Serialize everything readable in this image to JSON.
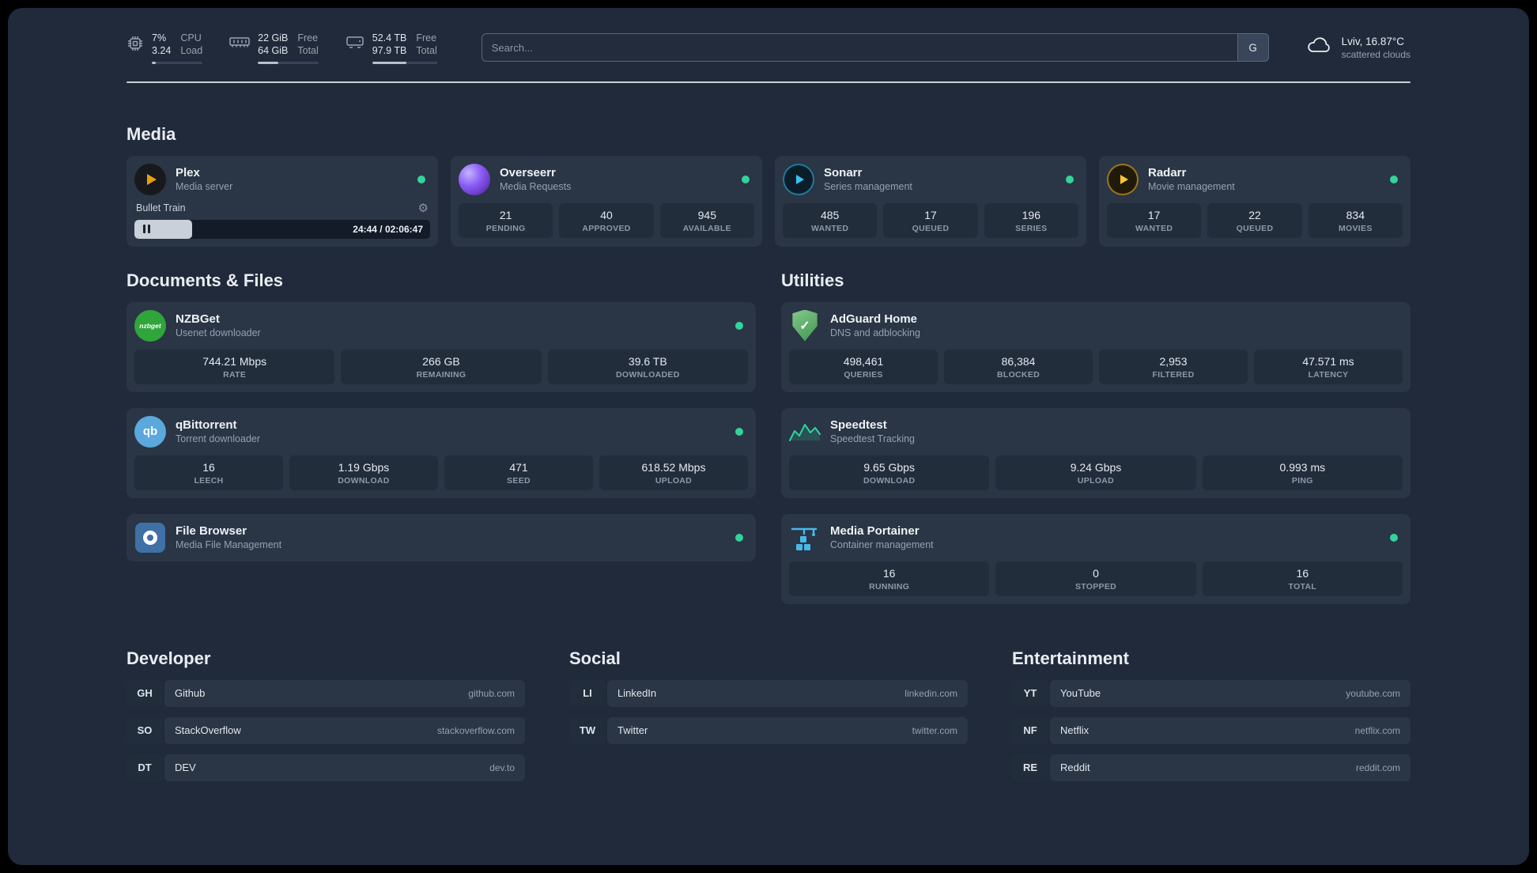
{
  "colors": {
    "status_online": "#34d399",
    "accent_plex": "#e5a00d",
    "accent_sonarr": "#35c5f4",
    "accent_radarr": "#ffc230",
    "accent_nzbget": "#2fa53b",
    "accent_qbittorrent": "#5ba8dc",
    "accent_adguard": "#6abd72",
    "accent_speedtest": "#2fd49c",
    "accent_portainer": "#49b8e8"
  },
  "icons": {
    "gear": "⚙",
    "adguard_check": "✓",
    "nzbget_label": "nzbget",
    "qbittorrent_label": "qb"
  },
  "topbar": {
    "cpu": {
      "value1": "7%",
      "value2": "3.24",
      "label1": "CPU",
      "label2": "Load"
    },
    "memory": {
      "value1": "22 GiB",
      "value2": "64 GiB",
      "label1": "Free",
      "label2": "Total"
    },
    "disk": {
      "value1": "52.4 TB",
      "value2": "97.9 TB",
      "label1": "Free",
      "label2": "Total"
    },
    "search": {
      "placeholder": "Search...",
      "provider_button": "G"
    },
    "weather": {
      "location": "Lviv, 16.87°C",
      "condition": "scattered clouds"
    }
  },
  "media": {
    "heading": "Media",
    "plex": {
      "title": "Plex",
      "subtitle": "Media server",
      "now_playing": "Bullet Train",
      "time": "24:44 / 02:06:47",
      "progress_percent": 19.5
    },
    "overseerr": {
      "title": "Overseerr",
      "subtitle": "Media Requests",
      "stats": [
        {
          "value": "21",
          "label": "PENDING"
        },
        {
          "value": "40",
          "label": "APPROVED"
        },
        {
          "value": "945",
          "label": "AVAILABLE"
        }
      ]
    },
    "sonarr": {
      "title": "Sonarr",
      "subtitle": "Series management",
      "stats": [
        {
          "value": "485",
          "label": "WANTED"
        },
        {
          "value": "17",
          "label": "QUEUED"
        },
        {
          "value": "196",
          "label": "SERIES"
        }
      ]
    },
    "radarr": {
      "title": "Radarr",
      "subtitle": "Movie management",
      "stats": [
        {
          "value": "17",
          "label": "WANTED"
        },
        {
          "value": "22",
          "label": "QUEUED"
        },
        {
          "value": "834",
          "label": "MOVIES"
        }
      ]
    }
  },
  "documents": {
    "heading": "Documents & Files",
    "nzbget": {
      "title": "NZBGet",
      "subtitle": "Usenet downloader",
      "stats": [
        {
          "value": "744.21 Mbps",
          "label": "RATE"
        },
        {
          "value": "266 GB",
          "label": "REMAINING"
        },
        {
          "value": "39.6 TB",
          "label": "DOWNLOADED"
        }
      ]
    },
    "qbittorrent": {
      "title": "qBittorrent",
      "subtitle": "Torrent downloader",
      "stats": [
        {
          "value": "16",
          "label": "LEECH"
        },
        {
          "value": "1.19 Gbps",
          "label": "DOWNLOAD"
        },
        {
          "value": "471",
          "label": "SEED"
        },
        {
          "value": "618.52 Mbps",
          "label": "UPLOAD"
        }
      ]
    },
    "filebrowser": {
      "title": "File Browser",
      "subtitle": "Media File Management"
    }
  },
  "utilities": {
    "heading": "Utilities",
    "adguard": {
      "title": "AdGuard Home",
      "subtitle": "DNS and adblocking",
      "stats": [
        {
          "value": "498,461",
          "label": "QUERIES"
        },
        {
          "value": "86,384",
          "label": "BLOCKED"
        },
        {
          "value": "2,953",
          "label": "FILTERED"
        },
        {
          "value": "47.571 ms",
          "label": "LATENCY"
        }
      ]
    },
    "speedtest": {
      "title": "Speedtest",
      "subtitle": "Speedtest Tracking",
      "stats": [
        {
          "value": "9.65 Gbps",
          "label": "DOWNLOAD"
        },
        {
          "value": "9.24 Gbps",
          "label": "UPLOAD"
        },
        {
          "value": "0.993 ms",
          "label": "PING"
        }
      ]
    },
    "portainer": {
      "title": "Media Portainer",
      "subtitle": "Container management",
      "stats": [
        {
          "value": "16",
          "label": "RUNNING"
        },
        {
          "value": "0",
          "label": "STOPPED"
        },
        {
          "value": "16",
          "label": "TOTAL"
        }
      ]
    }
  },
  "bookmarks": {
    "developer": {
      "heading": "Developer",
      "items": [
        {
          "abbr": "GH",
          "name": "Github",
          "url": "github.com"
        },
        {
          "abbr": "SO",
          "name": "StackOverflow",
          "url": "stackoverflow.com"
        },
        {
          "abbr": "DT",
          "name": "DEV",
          "url": "dev.to"
        }
      ]
    },
    "social": {
      "heading": "Social",
      "items": [
        {
          "abbr": "LI",
          "name": "LinkedIn",
          "url": "linkedin.com"
        },
        {
          "abbr": "TW",
          "name": "Twitter",
          "url": "twitter.com"
        }
      ]
    },
    "entertainment": {
      "heading": "Entertainment",
      "items": [
        {
          "abbr": "YT",
          "name": "YouTube",
          "url": "youtube.com"
        },
        {
          "abbr": "NF",
          "name": "Netflix",
          "url": "netflix.com"
        },
        {
          "abbr": "RE",
          "name": "Reddit",
          "url": "reddit.com"
        }
      ]
    }
  }
}
